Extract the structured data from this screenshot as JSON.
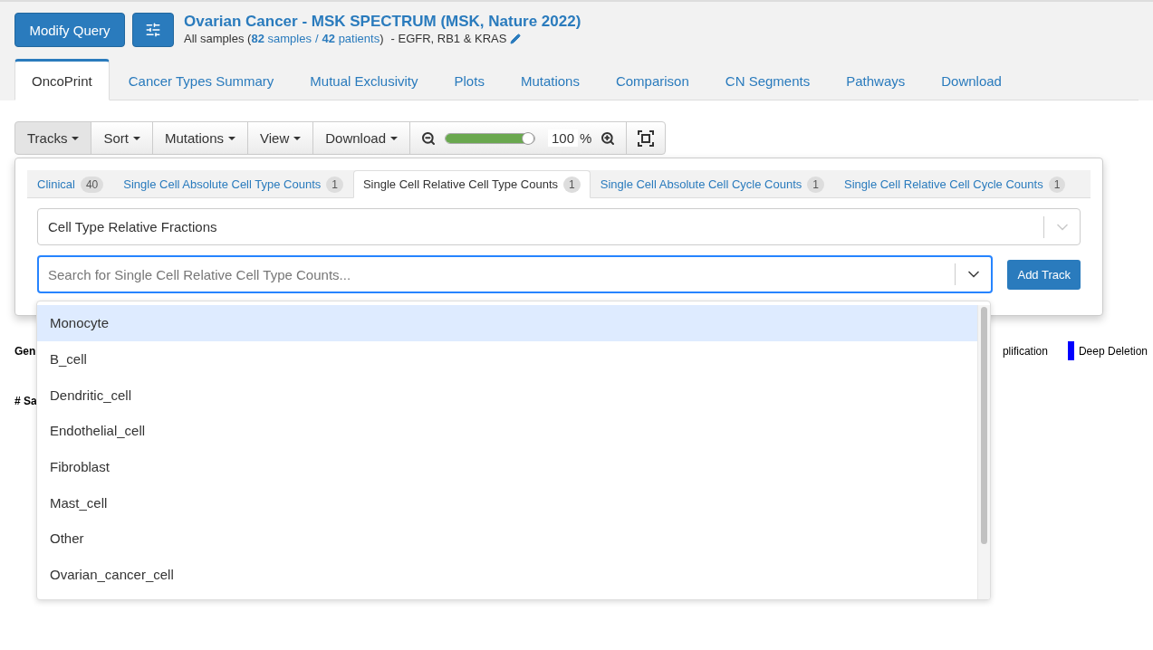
{
  "header": {
    "modify_button": "Modify Query",
    "title": "Ovarian Cancer - MSK SPECTRUM (MSK, Nature 2022)",
    "subtitle_prefix": "All samples (",
    "samples_link": "**82** samples",
    "separator": "/",
    "patients_link": "**42** patients",
    "subtitle_suffix": ")",
    "genes": "- EGFR, RB1 & KRAS"
  },
  "tabs": [
    {
      "label": "OncoPrint",
      "selected": true
    },
    {
      "label": "Cancer Types Summary",
      "selected": false
    },
    {
      "label": "Mutual Exclusivity",
      "selected": false
    },
    {
      "label": "Plots",
      "selected": false
    },
    {
      "label": "Mutations",
      "selected": false
    },
    {
      "label": "Comparison",
      "selected": false
    },
    {
      "label": "CN Segments",
      "selected": false
    },
    {
      "label": "Pathways",
      "selected": false
    },
    {
      "label": "Download",
      "selected": false
    }
  ],
  "toolbar": {
    "menus": [
      {
        "label": "Tracks",
        "open": true
      },
      {
        "label": "Sort",
        "open": false
      },
      {
        "label": "Mutations",
        "open": false
      },
      {
        "label": "View",
        "open": false
      },
      {
        "label": "Download",
        "open": false
      }
    ],
    "zoom": {
      "level": 0.93,
      "value": "100",
      "unit": "%"
    }
  },
  "track_panel": {
    "tabs": [
      {
        "label": "Clinical",
        "count": "40",
        "selected": false
      },
      {
        "label": "Single Cell Absolute Cell Type Counts",
        "count": "1",
        "selected": false
      },
      {
        "label": "Single Cell Relative Cell Type Counts",
        "count": "1",
        "selected": true
      },
      {
        "label": "Single Cell Absolute Cell Cycle Counts",
        "count": "1",
        "selected": false
      },
      {
        "label": "Single Cell Relative Cell Cycle Counts",
        "count": "1",
        "selected": false
      }
    ],
    "track_select": {
      "value": "Cell Type Relative Fractions"
    },
    "search": {
      "placeholder": "Search for Single Cell Relative Cell Type Counts..."
    },
    "add_button": "Add Track",
    "options": [
      {
        "label": "Monocyte",
        "selected": true
      },
      {
        "label": "B_cell",
        "selected": false
      },
      {
        "label": "Dendritic_cell",
        "selected": false
      },
      {
        "label": "Endothelial_cell",
        "selected": false
      },
      {
        "label": "Fibroblast",
        "selected": false
      },
      {
        "label": "Mast_cell",
        "selected": false
      },
      {
        "label": "Other",
        "selected": false
      },
      {
        "label": "Ovarian_cancer_cell",
        "selected": false
      }
    ]
  },
  "oncoprint": {
    "row_labels": [
      "Gen",
      "# Sa"
    ],
    "legend": [
      {
        "label": "plification"
      },
      {
        "label": "Deep Deletion",
        "color": "#0000ff"
      }
    ]
  }
}
